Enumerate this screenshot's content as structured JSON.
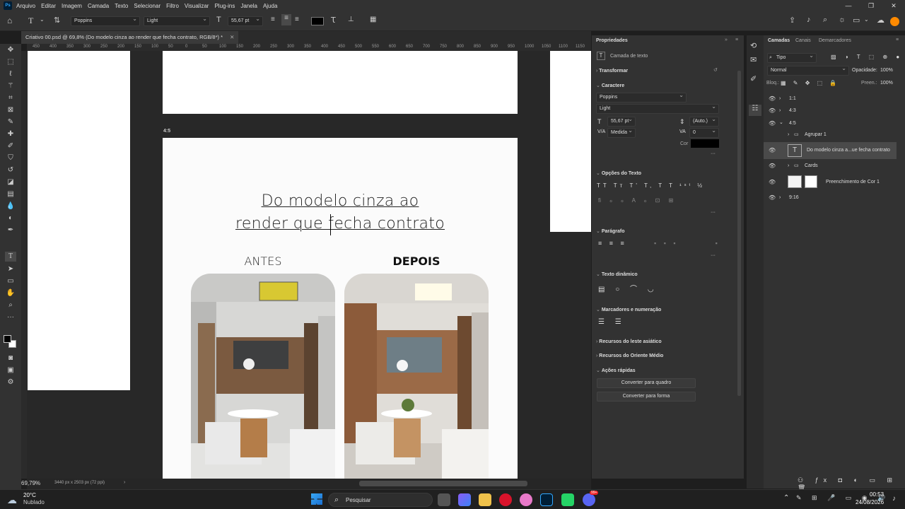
{
  "app": {
    "logo": "Ps",
    "menu": [
      "Arquivo",
      "Editar",
      "Imagem",
      "Camada",
      "Texto",
      "Selecionar",
      "Filtro",
      "Visualizar",
      "Plug-ins",
      "Janela",
      "Ajuda"
    ]
  },
  "options": {
    "font_family": "Poppins",
    "font_style": "Light",
    "font_size": "55,67 pt"
  },
  "document": {
    "tab_title": "Criativo 00.psd @ 69,8% (Do modelo cinza ao render que fecha contrato, RGB/8*) *",
    "zoom": "69,79%",
    "dims": "3440 px x 2503 px (72 ppi)",
    "artboard_label": "4:5"
  },
  "ruler": [
    "450",
    "400",
    "350",
    "300",
    "250",
    "200",
    "150",
    "100",
    "50",
    "0",
    "50",
    "100",
    "150",
    "200",
    "250",
    "300",
    "350",
    "400",
    "450",
    "500",
    "550",
    "600",
    "650",
    "700",
    "750",
    "800",
    "850",
    "900",
    "950",
    "1000",
    "1050",
    "1100",
    "1150"
  ],
  "artwork": {
    "headline_1": "Do modelo cinza ao",
    "headline_2": "render que fecha contrato",
    "before_label": "ANTES",
    "after_label": "DEPOIS"
  },
  "properties": {
    "title": "Propriedades",
    "layer_type": "Camada de texto",
    "transform": "Transformar",
    "character": "Caractere",
    "font": "Poppins",
    "style": "Light",
    "size": "55,67 pt",
    "leading": "(Auto.)",
    "kerning": "Medida",
    "tracking": "0",
    "color_label": "Cor",
    "text_options": "Opções do Texto",
    "paragraph": "Parágrafo",
    "dynamic_text": "Texto dinâmico",
    "bullets": "Marcadores e numeração",
    "east_asian": "Recursos do leste asiático",
    "middle_east": "Recursos do Oriente Médio",
    "quick_actions": "Ações rápidas",
    "convert_frame": "Converter para quadro",
    "convert_shape": "Converter para forma"
  },
  "layers": {
    "tabs": [
      "Camadas",
      "Canais",
      "Demarcadores"
    ],
    "filter": "Tipo",
    "blend": "Normal",
    "opacity_label": "Opacidade:",
    "opacity": "100%",
    "lock_label": "Bloq.:",
    "fill_label": "Preen.:",
    "fill": "100%",
    "items": [
      {
        "name": "1:1"
      },
      {
        "name": "4:3"
      },
      {
        "name": "4:5"
      },
      {
        "name": "Agrupar 1"
      },
      {
        "name": "Do modelo cinza a...ue fecha contrato"
      },
      {
        "name": "Cards"
      },
      {
        "name": "Preenchimento de Cor 1"
      },
      {
        "name": "9:16"
      }
    ]
  },
  "taskbar": {
    "weather_temp": "20°C",
    "weather_desc": "Nublado",
    "search": "Pesquisar",
    "time": "00:53",
    "date": "24/08/2026",
    "badge": "99+"
  },
  "colors": {
    "accent": "#1473e6",
    "ps_blue": "#31a8ff",
    "panel": "#323232"
  }
}
